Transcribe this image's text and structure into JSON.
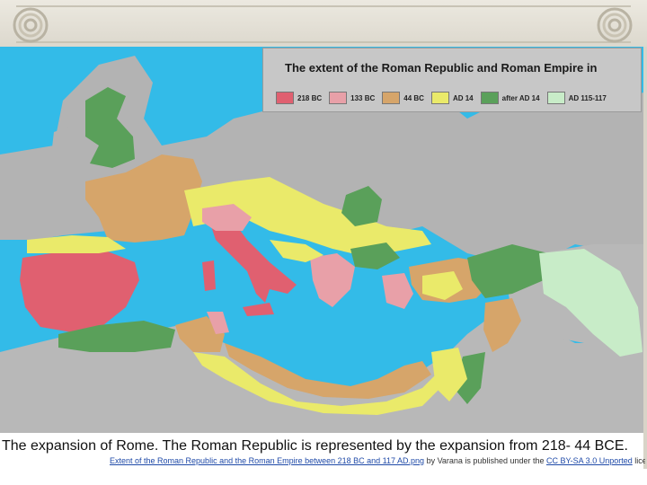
{
  "legend": {
    "title": "The extent of the Roman Republic and Roman Empire in",
    "items": [
      {
        "label": "218 BC",
        "color": "#e06070"
      },
      {
        "label": "133 BC",
        "color": "#e8a0a8"
      },
      {
        "label": "44 BC",
        "color": "#d6a56a"
      },
      {
        "label": "AD 14",
        "color": "#eaea6a"
      },
      {
        "label": "after AD 14",
        "color": "#5aa05a"
      },
      {
        "label": "AD 115-117",
        "color": "#c8ecc8"
      }
    ]
  },
  "caption": "The expansion of Rome. The Roman Republic is represented by the expansion from 218- 44 BCE.",
  "credit": {
    "link_title": "Extent of the Roman Republic and the Roman Empire between 218 BC and 117 AD.png",
    "by_text": " by Varana is published under the ",
    "license": "CC BY-SA 3.0 Unported",
    "license_suffix": " license"
  },
  "colors": {
    "sea": "#33bbe8",
    "land": "#b4b4b4",
    "header": "#e3e0d6"
  }
}
